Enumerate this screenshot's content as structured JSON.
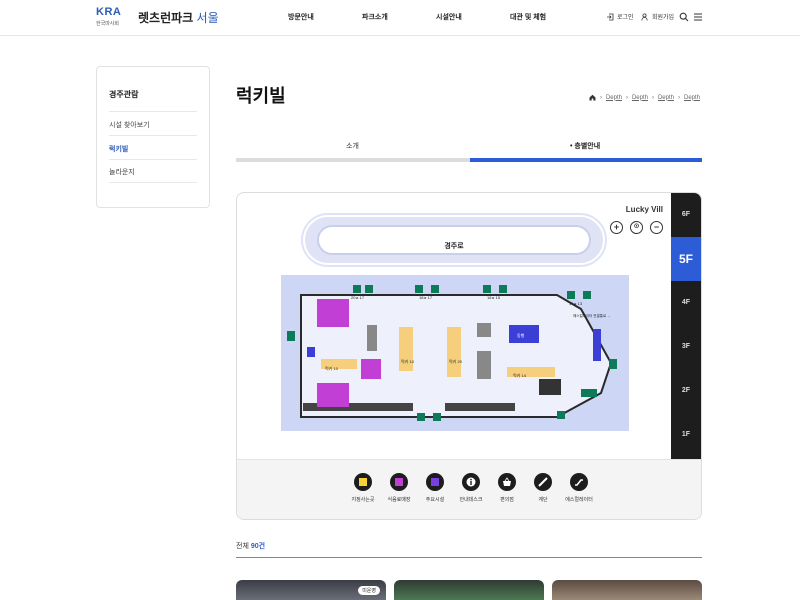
{
  "header": {
    "logo_kra": "KRA",
    "logo_sub": "한국마사회",
    "brand_main": "렛츠런파크",
    "brand_accent": "서울",
    "nav": [
      "방문안내",
      "파크소개",
      "시설안내",
      "대관 및 체험"
    ],
    "login": "로그인",
    "join": "회원가입"
  },
  "sidebar": {
    "title": "경주관람",
    "items": [
      {
        "label": "시설 찾아보기",
        "active": false
      },
      {
        "label": "럭키빌",
        "active": true
      },
      {
        "label": "놀라운지",
        "active": false
      }
    ]
  },
  "page": {
    "title": "럭키빌",
    "breadcrumb": [
      "Depth",
      "Depth",
      "Depth",
      "Depth"
    ]
  },
  "tabs": [
    {
      "label": "소개",
      "active": false
    },
    {
      "label": "층별안내",
      "active": true
    }
  ],
  "map": {
    "building": "Lucky Vill",
    "track_label": "경주로",
    "floors": [
      "6F",
      "5F",
      "4F",
      "3F",
      "2F",
      "1F"
    ],
    "selected_floor": "5F",
    "zoom": [
      "+",
      "⊙",
      "−"
    ],
    "rooms": {
      "room_a": "럭키 10",
      "room_b": "럭키 20",
      "room_c": "럭키 10",
      "room_d": "럭키 14",
      "room_e": "동행",
      "gate_1": "20 ▸ 17",
      "gate_2": "18 ▸ 17",
      "gate_3": "16 ▸ 15",
      "gate_4": "14 ▸ 13",
      "escalator_note": "에스컬레이터 연결통로 →"
    },
    "legend": [
      {
        "label": "지정사는곳",
        "icon": "yellow-square-icon",
        "color": "#f7d13a"
      },
      {
        "label": "식음료매장",
        "icon": "magenta-square-icon",
        "color": "#c23fd6"
      },
      {
        "label": "주요시설",
        "icon": "purple-square-icon",
        "color": "#7a3fe0"
      },
      {
        "label": "안내데스크",
        "icon": "info-icon",
        "color": "#ffffff"
      },
      {
        "label": "편의점",
        "icon": "basket-icon",
        "color": "#ffffff"
      },
      {
        "label": "계단",
        "icon": "stairs-icon",
        "color": "#ffffff"
      },
      {
        "label": "에스컬레이터",
        "icon": "escalator-icon",
        "color": "#ffffff"
      }
    ]
  },
  "list": {
    "count_prefix": "전체",
    "count_value": "90건",
    "first_tag": "미운영"
  }
}
